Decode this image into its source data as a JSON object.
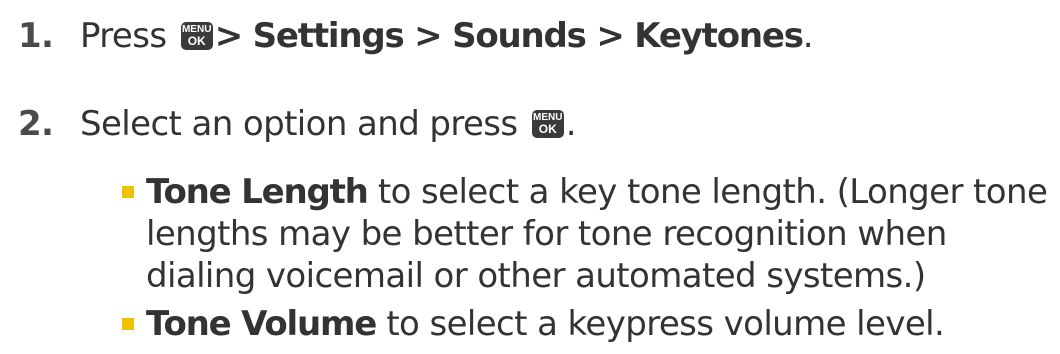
{
  "steps": [
    {
      "number": "1.",
      "text_before": "Press",
      "key": {
        "top": "MENU",
        "bottom": "OK"
      },
      "path": "> Settings > Sounds > Keytones",
      "text_after": "."
    },
    {
      "number": "2.",
      "text_before": "Select an option and press",
      "key": {
        "top": "MENU",
        "bottom": "OK"
      },
      "text_after": "."
    }
  ],
  "bullets": [
    {
      "term": "Tone Length",
      "lines": [
        " to select a key tone length. (Longer tone",
        "lengths may be better for tone recognition when",
        "dialing voicemail or other automated systems.)"
      ]
    },
    {
      "term": "Tone Volume",
      "lines": [
        " to select a keypress volume level."
      ]
    }
  ],
  "colors": {
    "text": "#333333",
    "key_background": "#3a3a3a",
    "bullet": "#f2c200"
  },
  "icons": {
    "menu_ok_key": "menu-ok-key-icon",
    "bullet": "square-bullet-icon"
  }
}
